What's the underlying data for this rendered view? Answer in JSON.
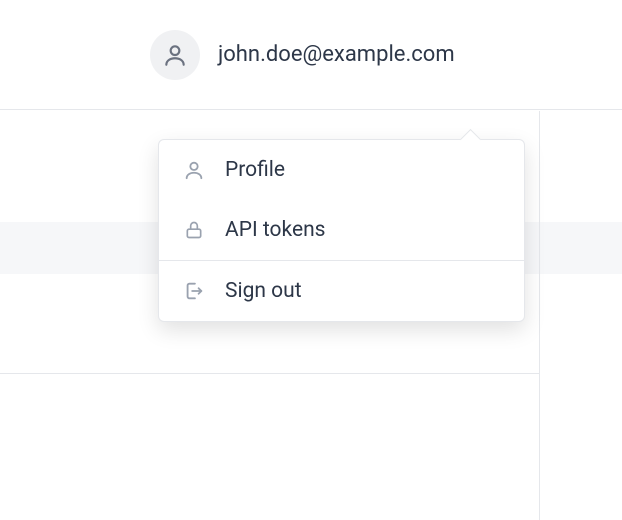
{
  "header": {
    "user_email": "john.doe@example.com"
  },
  "menu": {
    "items": [
      {
        "label": "Profile"
      },
      {
        "label": "API tokens"
      },
      {
        "label": "Sign out"
      }
    ]
  }
}
